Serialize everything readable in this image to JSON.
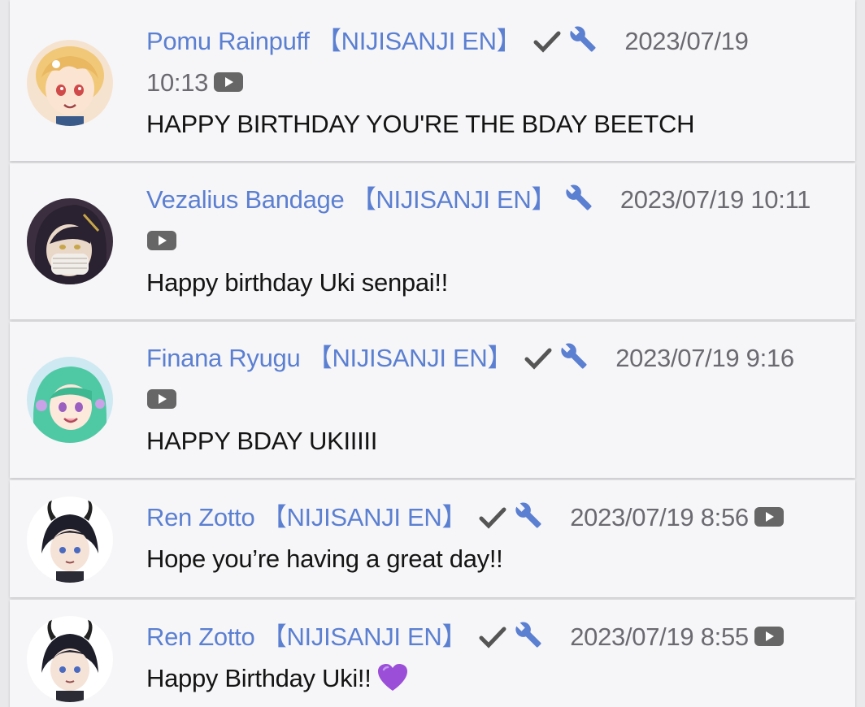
{
  "comments": [
    {
      "name": "Pomu Rainpuff",
      "tag": "【NIJISANJI EN】",
      "verified": true,
      "moderator": true,
      "date": "2023/07/19",
      "time": "10:13",
      "message": "HAPPY BIRTHDAY YOU'RE THE BDAY BEETCH",
      "avatar": "pomu-avatar"
    },
    {
      "name": "Vezalius Bandage",
      "tag": "【NIJISANJI EN】",
      "verified": false,
      "moderator": true,
      "date": "2023/07/19",
      "time": "10:11",
      "message": "Happy birthday Uki senpai!!",
      "avatar": "vezalius-avatar"
    },
    {
      "name": "Finana Ryugu",
      "tag": "【NIJISANJI EN】",
      "verified": true,
      "moderator": true,
      "date": "2023/07/19",
      "time": "9:16",
      "message": "HAPPY BDAY UKIIIII",
      "avatar": "finana-avatar"
    },
    {
      "name": "Ren Zotto",
      "tag": "【NIJISANJI EN】",
      "verified": true,
      "moderator": true,
      "date": "2023/07/19",
      "time": "8:56",
      "message": "Hope you’re having a great day!!",
      "avatar": "ren-avatar"
    },
    {
      "name": "Ren Zotto",
      "tag": "【NIJISANJI EN】",
      "verified": true,
      "moderator": true,
      "date": "2023/07/19",
      "time": "8:55",
      "message": "Happy Birthday Uki!!",
      "emoji": "purple-heart",
      "avatar": "ren-avatar"
    }
  ],
  "icons": {
    "verified": "check-icon",
    "moderator": "wrench-icon",
    "source": "youtube-icon"
  },
  "colors": {
    "name": "#5b7fd1",
    "meta": "#6a6a70",
    "card": "#f6f6f8",
    "background": "#e9e9ec"
  }
}
